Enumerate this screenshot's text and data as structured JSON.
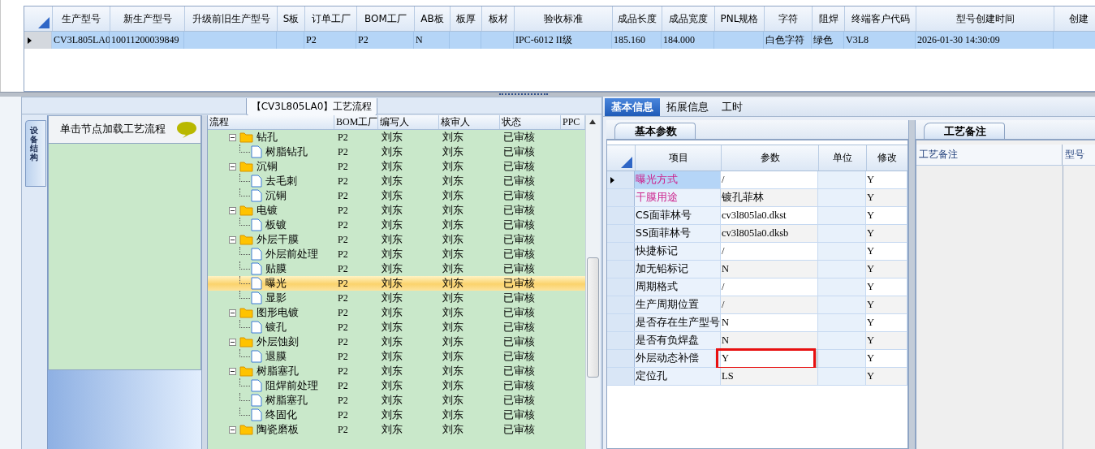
{
  "main_grid": {
    "columns": [
      "生产型号",
      "新生产型号",
      "升级前旧生产型号",
      "S板",
      "订单工厂",
      "BOM工厂",
      "AB板",
      "板厚",
      "板材",
      "验收标准",
      "成品长度",
      "成品宽度",
      "PNL规格",
      "字符",
      "阻焊",
      "终端客户代码",
      "型号创建时间",
      "创建"
    ],
    "rows": [
      {
        "selected": true,
        "cells": [
          "CV3L805LA0",
          "10011200039849",
          null,
          null,
          "P2",
          "P2",
          "N",
          null,
          null,
          "IPC-6012 II级",
          "185.160",
          "184.000",
          null,
          "白色字符",
          "绿色",
          "V3L8",
          "2026-01-30 14:30:09",
          null
        ]
      }
    ]
  },
  "process_panel": {
    "title": "【CV3L805LA0】工艺流程",
    "side_tab": "设备结构",
    "hint": "单击节点加载工艺流程",
    "columns": [
      "流程",
      "BOM工厂",
      "编写人",
      "核审人",
      "状态",
      "PPC"
    ],
    "tree": [
      {
        "name": "钻孔",
        "bom": "P2",
        "writer": "刘东",
        "reviewer": "刘东",
        "status": "已审核",
        "selected": false,
        "expanded": true,
        "children": [
          {
            "name": "树脂钻孔",
            "bom": "P2",
            "writer": "刘东",
            "reviewer": "刘东",
            "status": "已审核",
            "selected": false
          }
        ]
      },
      {
        "name": "沉铜",
        "bom": "P2",
        "writer": "刘东",
        "reviewer": "刘东",
        "status": "已审核",
        "selected": false,
        "expanded": true,
        "children": [
          {
            "name": "去毛刺",
            "bom": "P2",
            "writer": "刘东",
            "reviewer": "刘东",
            "status": "已审核",
            "selected": false
          },
          {
            "name": "沉铜",
            "bom": "P2",
            "writer": "刘东",
            "reviewer": "刘东",
            "status": "已审核",
            "selected": false
          }
        ]
      },
      {
        "name": "电镀",
        "bom": "P2",
        "writer": "刘东",
        "reviewer": "刘东",
        "status": "已审核",
        "selected": false,
        "expanded": true,
        "children": [
          {
            "name": "板镀",
            "bom": "P2",
            "writer": "刘东",
            "reviewer": "刘东",
            "status": "已审核",
            "selected": false
          }
        ]
      },
      {
        "name": "外层干膜",
        "bom": "P2",
        "writer": "刘东",
        "reviewer": "刘东",
        "status": "已审核",
        "selected": false,
        "expanded": true,
        "children": [
          {
            "name": "外层前处理",
            "bom": "P2",
            "writer": "刘东",
            "reviewer": "刘东",
            "status": "已审核",
            "selected": false
          },
          {
            "name": "贴膜",
            "bom": "P2",
            "writer": "刘东",
            "reviewer": "刘东",
            "status": "已审核",
            "selected": false
          },
          {
            "name": "曝光",
            "bom": "P2",
            "writer": "刘东",
            "reviewer": "刘东",
            "status": "已审核",
            "selected": true
          },
          {
            "name": "显影",
            "bom": "P2",
            "writer": "刘东",
            "reviewer": "刘东",
            "status": "已审核",
            "selected": false
          }
        ]
      },
      {
        "name": "图形电镀",
        "bom": "P2",
        "writer": "刘东",
        "reviewer": "刘东",
        "status": "已审核",
        "selected": false,
        "expanded": true,
        "children": [
          {
            "name": "镀孔",
            "bom": "P2",
            "writer": "刘东",
            "reviewer": "刘东",
            "status": "已审核",
            "selected": false
          }
        ]
      },
      {
        "name": "外层蚀刻",
        "bom": "P2",
        "writer": "刘东",
        "reviewer": "刘东",
        "status": "已审核",
        "selected": false,
        "expanded": true,
        "children": [
          {
            "name": "退膜",
            "bom": "P2",
            "writer": "刘东",
            "reviewer": "刘东",
            "status": "已审核",
            "selected": false
          }
        ]
      },
      {
        "name": "树脂塞孔",
        "bom": "P2",
        "writer": "刘东",
        "reviewer": "刘东",
        "status": "已审核",
        "selected": false,
        "expanded": true,
        "children": [
          {
            "name": "阻焊前处理",
            "bom": "P2",
            "writer": "刘东",
            "reviewer": "刘东",
            "status": "已审核",
            "selected": false
          },
          {
            "name": "树脂塞孔",
            "bom": "P2",
            "writer": "刘东",
            "reviewer": "刘东",
            "status": "已审核",
            "selected": false
          },
          {
            "name": "终固化",
            "bom": "P2",
            "writer": "刘东",
            "reviewer": "刘东",
            "status": "已审核",
            "selected": false
          }
        ]
      },
      {
        "name": "陶瓷磨板",
        "bom": "P2",
        "writer": "刘东",
        "reviewer": "刘东",
        "status": "已审核",
        "selected": false,
        "expanded": true
      }
    ]
  },
  "detail_tabs": [
    {
      "label": "基本信息",
      "selected": true
    },
    {
      "label": "拓展信息",
      "selected": false
    },
    {
      "label": "工时",
      "selected": false
    }
  ],
  "param_panel": {
    "tab": "基本参数",
    "columns": [
      "项目",
      "参数",
      "单位",
      "修改"
    ],
    "rows": [
      {
        "item": "曝光方式",
        "value": "/",
        "modified": "Y",
        "emphasized": true,
        "selected": true,
        "annotated": false
      },
      {
        "item": "干膜用途",
        "value": "镀孔菲林",
        "modified": "Y",
        "emphasized": true,
        "selected": false,
        "annotated": false
      },
      {
        "item": "CS面菲林号",
        "value": "cv3l805la0.dkst",
        "modified": "Y",
        "emphasized": false,
        "selected": false,
        "annotated": false
      },
      {
        "item": "SS面菲林号",
        "value": "cv3l805la0.dksb",
        "modified": "Y",
        "emphasized": false,
        "selected": false,
        "annotated": false
      },
      {
        "item": "快捷标记",
        "value": "/",
        "modified": "Y",
        "emphasized": false,
        "selected": false,
        "annotated": false
      },
      {
        "item": "加无铅标记",
        "value": "N",
        "modified": "Y",
        "emphasized": false,
        "selected": false,
        "annotated": false
      },
      {
        "item": "周期格式",
        "value": "/",
        "modified": "Y",
        "emphasized": false,
        "selected": false,
        "annotated": false
      },
      {
        "item": "生产周期位置",
        "value": "/",
        "modified": "Y",
        "emphasized": false,
        "selected": false,
        "annotated": false
      },
      {
        "item": "是否存在生产型号",
        "value": "N",
        "modified": "Y",
        "emphasized": false,
        "selected": false,
        "annotated": false
      },
      {
        "item": "是否有负焊盘",
        "value": "N",
        "modified": "Y",
        "emphasized": false,
        "selected": false,
        "annotated": false
      },
      {
        "item": "外层动态补偿",
        "value": "Y",
        "modified": "Y",
        "emphasized": false,
        "selected": false,
        "annotated": true
      },
      {
        "item": "定位孔",
        "value": "LS",
        "modified": "Y",
        "emphasized": false,
        "selected": false,
        "annotated": false
      }
    ]
  },
  "remark_panel": {
    "tab": "工艺备注",
    "columns": [
      "工艺备注",
      "型号"
    ]
  }
}
